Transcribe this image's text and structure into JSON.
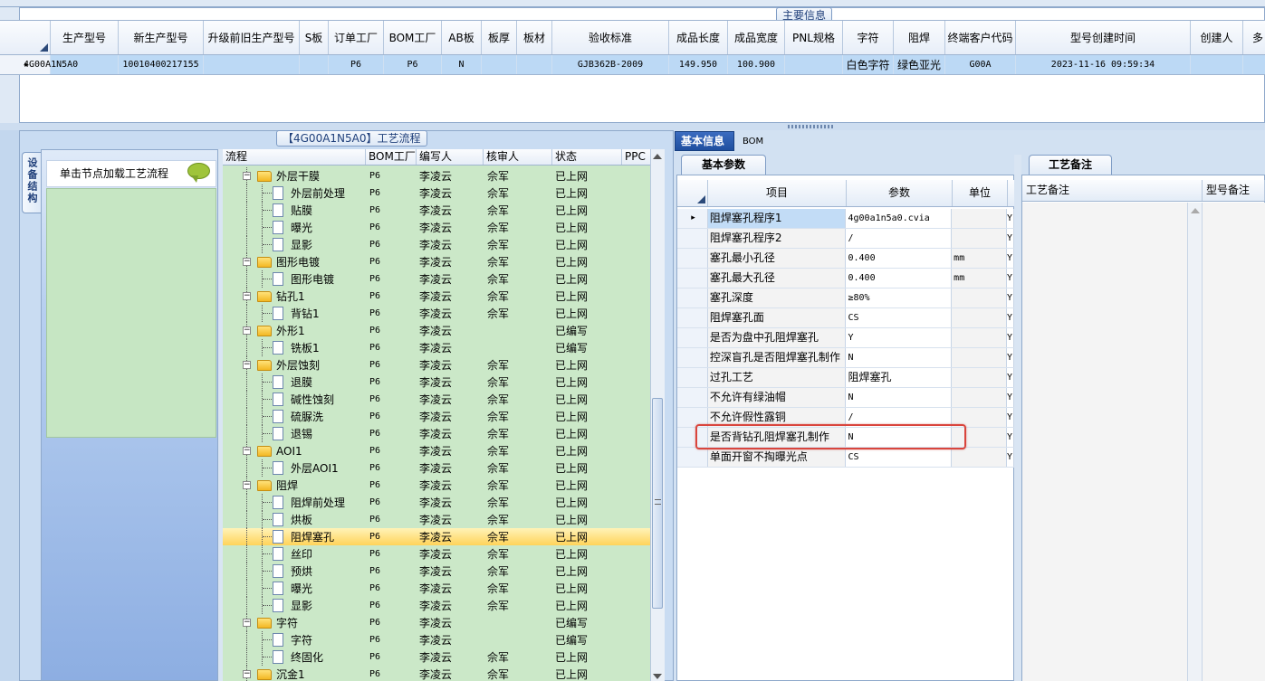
{
  "main": {
    "caption": "主要信息",
    "columns": [
      "生产型号",
      "新生产型号",
      "升级前旧生产型号",
      "S板",
      "订单工厂",
      "BOM工厂",
      "AB板",
      "板厚",
      "板材",
      "验收标准",
      "成品长度",
      "成品宽度",
      "PNL规格",
      "字符",
      "阻焊",
      "终端客户代码",
      "型号创建时间",
      "创建人",
      "多"
    ],
    "row": [
      "4G00A1N5A0",
      "10010400217155",
      "",
      "",
      "P6",
      "P6",
      "N",
      "",
      "",
      "GJB362B-2009",
      "149.950",
      "100.900",
      "",
      "白色字符",
      "绿色亚光",
      "G00A",
      "2023-11-16 09:59:34",
      "",
      ""
    ]
  },
  "left": {
    "vertical_tab": "设备结构",
    "nav_header": "单击节点加载工艺流程",
    "flow_caption": "【4G00A1N5A0】工艺流程",
    "tree_columns": [
      "流程",
      "BOM工厂",
      "编写人",
      "核审人",
      "状态",
      "PPC"
    ],
    "tree_rows": [
      {
        "level": 0,
        "name": "外层干膜",
        "bom": "P6",
        "writer": "李凌云",
        "reviewer": "佘军",
        "status": "已上网"
      },
      {
        "level": 1,
        "name": "外层前处理",
        "bom": "P6",
        "writer": "李凌云",
        "reviewer": "佘军",
        "status": "已上网"
      },
      {
        "level": 1,
        "name": "贴膜",
        "bom": "P6",
        "writer": "李凌云",
        "reviewer": "佘军",
        "status": "已上网"
      },
      {
        "level": 1,
        "name": "曝光",
        "bom": "P6",
        "writer": "李凌云",
        "reviewer": "佘军",
        "status": "已上网"
      },
      {
        "level": 1,
        "name": "显影",
        "bom": "P6",
        "writer": "李凌云",
        "reviewer": "佘军",
        "status": "已上网"
      },
      {
        "level": 0,
        "name": "图形电镀",
        "bom": "P6",
        "writer": "李凌云",
        "reviewer": "佘军",
        "status": "已上网"
      },
      {
        "level": 1,
        "name": "图形电镀",
        "bom": "P6",
        "writer": "李凌云",
        "reviewer": "佘军",
        "status": "已上网"
      },
      {
        "level": 0,
        "name": "钻孔1",
        "bom": "P6",
        "writer": "李凌云",
        "reviewer": "佘军",
        "status": "已上网"
      },
      {
        "level": 1,
        "name": "背钻1",
        "bom": "P6",
        "writer": "李凌云",
        "reviewer": "佘军",
        "status": "已上网"
      },
      {
        "level": 0,
        "name": "外形1",
        "bom": "P6",
        "writer": "李凌云",
        "reviewer": "",
        "status": "已编写"
      },
      {
        "level": 1,
        "name": "铣板1",
        "bom": "P6",
        "writer": "李凌云",
        "reviewer": "",
        "status": "已编写"
      },
      {
        "level": 0,
        "name": "外层蚀刻",
        "bom": "P6",
        "writer": "李凌云",
        "reviewer": "佘军",
        "status": "已上网"
      },
      {
        "level": 1,
        "name": "退膜",
        "bom": "P6",
        "writer": "李凌云",
        "reviewer": "佘军",
        "status": "已上网"
      },
      {
        "level": 1,
        "name": "碱性蚀刻",
        "bom": "P6",
        "writer": "李凌云",
        "reviewer": "佘军",
        "status": "已上网"
      },
      {
        "level": 1,
        "name": "硫脲洗",
        "bom": "P6",
        "writer": "李凌云",
        "reviewer": "佘军",
        "status": "已上网"
      },
      {
        "level": 1,
        "name": "退锡",
        "bom": "P6",
        "writer": "李凌云",
        "reviewer": "佘军",
        "status": "已上网"
      },
      {
        "level": 0,
        "name": "AOI1",
        "bom": "P6",
        "writer": "李凌云",
        "reviewer": "佘军",
        "status": "已上网"
      },
      {
        "level": 1,
        "name": "外层AOI1",
        "bom": "P6",
        "writer": "李凌云",
        "reviewer": "佘军",
        "status": "已上网"
      },
      {
        "level": 0,
        "name": "阻焊",
        "bom": "P6",
        "writer": "李凌云",
        "reviewer": "佘军",
        "status": "已上网"
      },
      {
        "level": 1,
        "name": "阻焊前处理",
        "bom": "P6",
        "writer": "李凌云",
        "reviewer": "佘军",
        "status": "已上网"
      },
      {
        "level": 1,
        "name": "烘板",
        "bom": "P6",
        "writer": "李凌云",
        "reviewer": "佘军",
        "status": "已上网"
      },
      {
        "level": 1,
        "name": "阻焊塞孔",
        "bom": "P6",
        "writer": "李凌云",
        "reviewer": "佘军",
        "status": "已上网",
        "selected": true
      },
      {
        "level": 1,
        "name": "丝印",
        "bom": "P6",
        "writer": "李凌云",
        "reviewer": "佘军",
        "status": "已上网"
      },
      {
        "level": 1,
        "name": "预烘",
        "bom": "P6",
        "writer": "李凌云",
        "reviewer": "佘军",
        "status": "已上网"
      },
      {
        "level": 1,
        "name": "曝光",
        "bom": "P6",
        "writer": "李凌云",
        "reviewer": "佘军",
        "status": "已上网"
      },
      {
        "level": 1,
        "name": "显影",
        "bom": "P6",
        "writer": "李凌云",
        "reviewer": "佘军",
        "status": "已上网"
      },
      {
        "level": 0,
        "name": "字符",
        "bom": "P6",
        "writer": "李凌云",
        "reviewer": "",
        "status": "已编写"
      },
      {
        "level": 1,
        "name": "字符",
        "bom": "P6",
        "writer": "李凌云",
        "reviewer": "",
        "status": "已编写"
      },
      {
        "level": 1,
        "name": "终固化",
        "bom": "P6",
        "writer": "李凌云",
        "reviewer": "佘军",
        "status": "已上网"
      },
      {
        "level": 0,
        "name": "沉金1",
        "bom": "P6",
        "writer": "李凌云",
        "reviewer": "佘军",
        "status": "已上网"
      }
    ]
  },
  "right": {
    "tabs": [
      "基本信息",
      "BOM"
    ],
    "param_tab": "基本参数",
    "param_columns": [
      "项目",
      "参数",
      "单位"
    ],
    "params": [
      {
        "item": "阻焊塞孔程序1",
        "value": "4g00a1n5a0.cvia",
        "unit": "",
        "flag": "Y",
        "current": true
      },
      {
        "item": "阻焊塞孔程序2",
        "value": "/",
        "unit": "",
        "flag": "Y"
      },
      {
        "item": "塞孔最小孔径",
        "value": "0.400",
        "unit": "mm",
        "flag": "Y"
      },
      {
        "item": "塞孔最大孔径",
        "value": "0.400",
        "unit": "mm",
        "flag": "Y"
      },
      {
        "item": "塞孔深度",
        "value": "≥80%",
        "unit": "",
        "flag": "Y"
      },
      {
        "item": "阻焊塞孔面",
        "value": "CS",
        "unit": "",
        "flag": "Y"
      },
      {
        "item": "是否为盘中孔阻焊塞孔",
        "value": "Y",
        "unit": "",
        "flag": "Y"
      },
      {
        "item": "控深盲孔是否阻焊塞孔制作",
        "value": "N",
        "unit": "",
        "flag": "Y"
      },
      {
        "item": "过孔工艺",
        "value": "阻焊塞孔",
        "unit": "",
        "flag": "Y"
      },
      {
        "item": "不允许有绿油帽",
        "value": "N",
        "unit": "",
        "flag": "Y"
      },
      {
        "item": "不允许假性露铜",
        "value": "/",
        "unit": "",
        "flag": "Y"
      },
      {
        "item": "是否背钻孔阻焊塞孔制作",
        "value": "N",
        "unit": "",
        "flag": "Y"
      },
      {
        "item": "单面开窗不掏曝光点",
        "value": "CS",
        "unit": "",
        "flag": "Y"
      }
    ],
    "note_tab": "工艺备注",
    "note_columns": [
      "工艺备注",
      "型号备注"
    ]
  }
}
